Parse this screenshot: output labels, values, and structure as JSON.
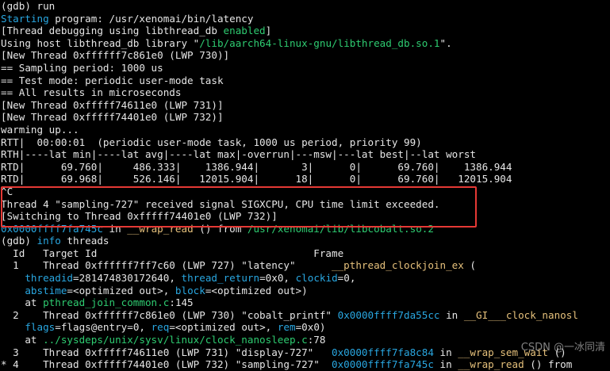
{
  "terminal": {
    "lines": [
      [
        {
          "t": "(gdb) run",
          "c": "white"
        }
      ],
      [
        {
          "t": "Starting",
          "c": "blue"
        },
        {
          "t": " program: /usr/xenomai/bin/latency",
          "c": "white"
        }
      ],
      [
        {
          "t": "[Thread debugging using libthread_db ",
          "c": "white"
        },
        {
          "t": "enabled",
          "c": "green"
        },
        {
          "t": "]",
          "c": "white"
        }
      ],
      [
        {
          "t": "Using host libthread_db library \"",
          "c": "white"
        },
        {
          "t": "/lib/aarch64-linux-gnu/libthread_db.so.1",
          "c": "green"
        },
        {
          "t": "\".",
          "c": "white"
        }
      ],
      [
        {
          "t": "[New Thread 0xffffff7c861e0 (LWP 730)]",
          "c": "white"
        }
      ],
      [
        {
          "t": "== Sampling period: 1000 us",
          "c": "white"
        }
      ],
      [
        {
          "t": "== Test mode: periodic user-mode task",
          "c": "white"
        }
      ],
      [
        {
          "t": "== All results in microseconds",
          "c": "white"
        }
      ],
      [
        {
          "t": "[New Thread 0xfffff74611e0 (LWP 731)]",
          "c": "white"
        }
      ],
      [
        {
          "t": "[New Thread 0xfffff74401e0 (LWP 732)]",
          "c": "white"
        }
      ],
      [
        {
          "t": "warming up...",
          "c": "white"
        }
      ],
      [
        {
          "t": "RTT|  00:00:01  (periodic user-mode task, 1000 us period, priority 99)",
          "c": "white"
        }
      ],
      [
        {
          "t": "RTH|----lat min|----lat avg|----lat max|-overrun|---msw|---lat best|--lat worst",
          "c": "white"
        }
      ],
      [
        {
          "t": "RTD|      69.760|     486.333|    1386.944|       3|      0|      69.760|    1386.944",
          "c": "white"
        }
      ],
      [
        {
          "t": "RTD|      69.968|     526.146|   12015.904|      18|      0|      69.760|   12015.904",
          "c": "white"
        }
      ],
      [
        {
          "t": "^C",
          "c": "white"
        }
      ],
      [
        {
          "t": "Thread 4 \"sampling-727\" received signal SIGXCPU, CPU time limit exceeded.",
          "c": "white"
        }
      ],
      [
        {
          "t": "[Switching to Thread 0xfffff74401e0 (LWP 732)]",
          "c": "white"
        }
      ],
      [
        {
          "t": "0x0000ffff7fa745c",
          "c": "blue"
        },
        {
          "t": " in ",
          "c": "white"
        },
        {
          "t": "__wrap_read",
          "c": "yellow"
        },
        {
          "t": " () from ",
          "c": "white"
        },
        {
          "t": "/usr/xenomai/lib/libcobalt.so.2",
          "c": "green"
        }
      ],
      [
        {
          "t": "(gdb) ",
          "c": "white"
        },
        {
          "t": "info",
          "c": "blue"
        },
        {
          "t": " threads",
          "c": "white"
        }
      ],
      [
        {
          "t": "  Id   Target Id                                    Frame",
          "c": "white"
        }
      ],
      [
        {
          "t": "  1    Thread 0xffffff7ff7c60 (LWP 727) \"latency\"      ",
          "c": "white"
        },
        {
          "t": "__pthread_clockjoin_ex",
          "c": "yellow"
        },
        {
          "t": " (",
          "c": "white"
        }
      ],
      [
        {
          "t": "    ",
          "c": "white"
        },
        {
          "t": "threadid",
          "c": "blue"
        },
        {
          "t": "=281474830172640, ",
          "c": "white"
        },
        {
          "t": "thread_return",
          "c": "blue"
        },
        {
          "t": "=0x0, ",
          "c": "white"
        },
        {
          "t": "clockid",
          "c": "blue"
        },
        {
          "t": "=0,",
          "c": "white"
        }
      ],
      [
        {
          "t": "    ",
          "c": "white"
        },
        {
          "t": "abstime",
          "c": "blue"
        },
        {
          "t": "=<optimized out>, ",
          "c": "white"
        },
        {
          "t": "block",
          "c": "blue"
        },
        {
          "t": "=<optimized out>)",
          "c": "white"
        }
      ],
      [
        {
          "t": "    at ",
          "c": "white"
        },
        {
          "t": "pthread_join_common.c",
          "c": "green"
        },
        {
          "t": ":145",
          "c": "white"
        }
      ],
      [
        {
          "t": "  2    Thread 0xffffff7c861e0 (LWP 730) \"cobalt_printf\" ",
          "c": "white"
        },
        {
          "t": "0x0000ffff7da55cc",
          "c": "blue"
        },
        {
          "t": " in ",
          "c": "white"
        },
        {
          "t": "__GI___clock_nanosl",
          "c": "yellow"
        }
      ],
      [
        {
          "t": "    ",
          "c": "white"
        },
        {
          "t": "flags",
          "c": "blue"
        },
        {
          "t": "=flags@entry=0, ",
          "c": "white"
        },
        {
          "t": "req",
          "c": "blue"
        },
        {
          "t": "=<optimized out>, ",
          "c": "white"
        },
        {
          "t": "rem",
          "c": "blue"
        },
        {
          "t": "=0x0)",
          "c": "white"
        }
      ],
      [
        {
          "t": "    at ",
          "c": "white"
        },
        {
          "t": "../sysdeps/unix/sysv/linux/clock_nanosleep.c",
          "c": "green"
        },
        {
          "t": ":78",
          "c": "white"
        }
      ],
      [
        {
          "t": "  3    Thread 0xfffff74611e0 (LWP 731) \"display-727\"   ",
          "c": "white"
        },
        {
          "t": "0x0000ffff7fa8c84",
          "c": "blue"
        },
        {
          "t": " in ",
          "c": "white"
        },
        {
          "t": "__wrap_sem_wait",
          "c": "yellow"
        },
        {
          "t": " ()",
          "c": "white"
        }
      ],
      [
        {
          "t": "* 4    Thread 0xfffff74401e0 (LWP 732) \"sampling-727\"  ",
          "c": "white"
        },
        {
          "t": "0x0000ffff7fa745c",
          "c": "blue"
        },
        {
          "t": " in ",
          "c": "white"
        },
        {
          "t": "__wrap_read",
          "c": "yellow"
        },
        {
          "t": " () from",
          "c": "white"
        }
      ]
    ]
  },
  "watermark": "CSDN @一冰同清",
  "colors": {
    "background": "#000000",
    "text": "#e6e6e6",
    "blue": "#29a7e1",
    "green": "#2ecc71",
    "yellow": "#e5c07b",
    "highlight_border": "#e53935"
  }
}
